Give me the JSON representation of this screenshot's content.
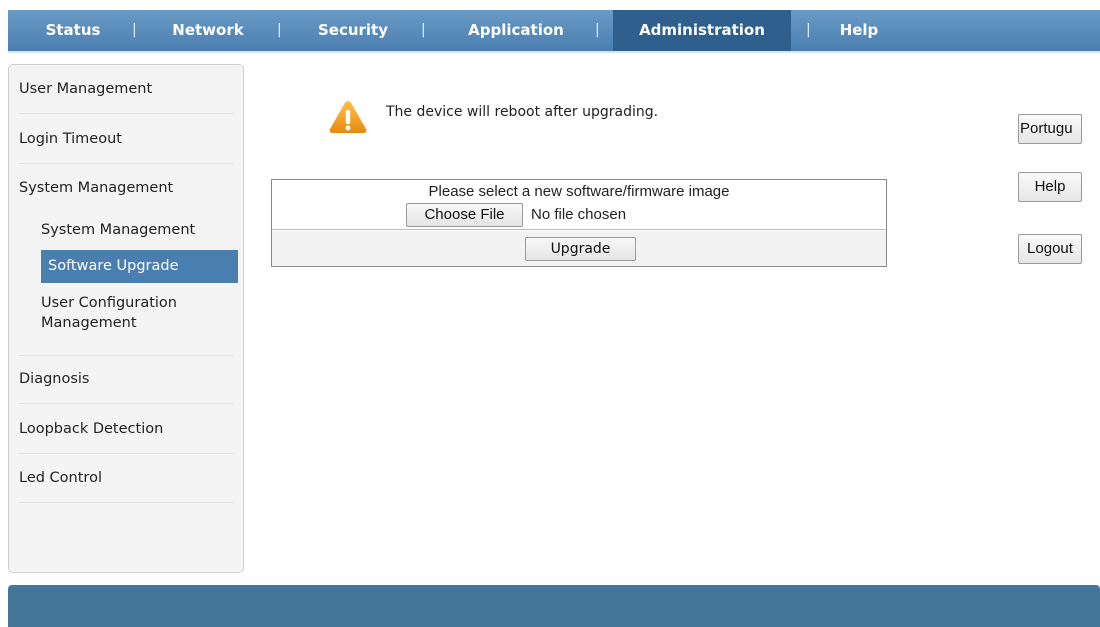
{
  "nav": {
    "items": [
      {
        "label": "Status"
      },
      {
        "label": "Network"
      },
      {
        "label": "Security"
      },
      {
        "label": "Application"
      },
      {
        "label": "Administration",
        "active": true
      },
      {
        "label": "Help"
      }
    ],
    "separator": "|"
  },
  "sidebar": {
    "items": [
      {
        "label": "User Management"
      },
      {
        "label": "Login Timeout"
      },
      {
        "label": "System Management"
      },
      {
        "label": "Diagnosis"
      },
      {
        "label": "Loopback Detection"
      },
      {
        "label": "Led Control"
      }
    ],
    "sub_items": [
      {
        "label": "System Management"
      },
      {
        "label": "Software Upgrade",
        "selected": true
      },
      {
        "label": "User Configuration Management"
      }
    ]
  },
  "main": {
    "warning_text": "The device will reboot after upgrading.",
    "prompt": "Please select a new software/firmware image",
    "choose_file_label": "Choose File",
    "file_status": "No file chosen",
    "upgrade_label": "Upgrade"
  },
  "right_buttons": {
    "language": "Portugu",
    "help": "Help",
    "logout": "Logout"
  },
  "colors": {
    "nav_bar": "#5a8dbb",
    "nav_active": "#2f5f8d",
    "sidebar_selected": "#4a7eaf",
    "footer": "#44769b",
    "warning_icon": "#f0a020"
  }
}
